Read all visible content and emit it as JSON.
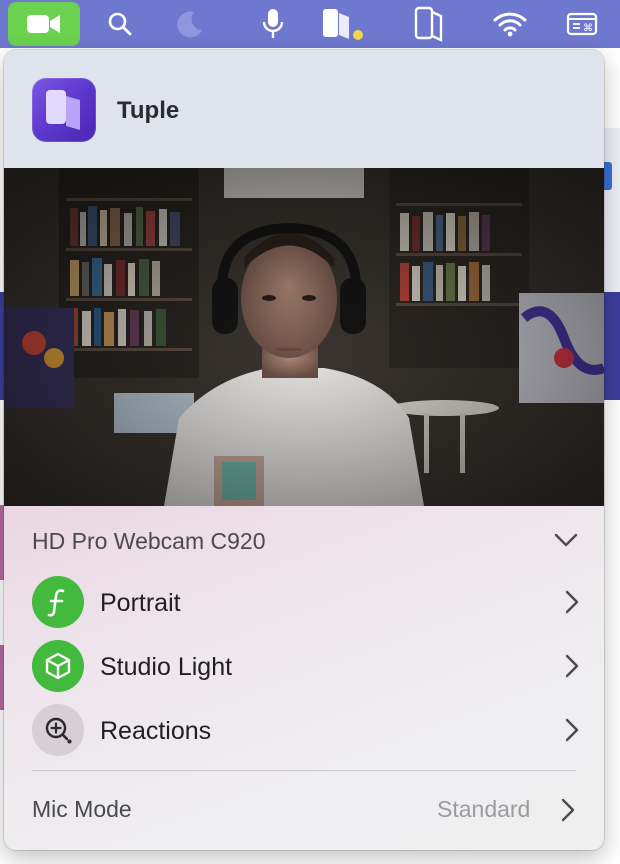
{
  "menubar": {
    "items": [
      {
        "name": "video-camera-icon"
      },
      {
        "name": "search-icon"
      },
      {
        "name": "moon-icon"
      },
      {
        "name": "microphone-icon"
      },
      {
        "name": "tuple-menu-icon"
      },
      {
        "name": "tuple-window-icon"
      },
      {
        "name": "wifi-icon"
      },
      {
        "name": "keyboard-shortcut-icon"
      }
    ],
    "colors": {
      "bar": "#6f78cf",
      "camera_active": "#6ad24f",
      "badge_dot": "#f4d64a"
    }
  },
  "popover": {
    "app_name": "Tuple",
    "camera": {
      "device_name": "HD Pro Webcam C920"
    },
    "effects": [
      {
        "label": "Portrait",
        "icon": "portrait-f-icon",
        "enabled": true
      },
      {
        "label": "Studio Light",
        "icon": "cube-icon",
        "enabled": true
      },
      {
        "label": "Reactions",
        "icon": "reactions-icon",
        "enabled": false
      }
    ],
    "mic_mode": {
      "label": "Mic Mode",
      "value": "Standard"
    },
    "colors": {
      "enabled_icon_bg": "#43b93d",
      "disabled_icon_bg": "#d6cfd6"
    }
  }
}
